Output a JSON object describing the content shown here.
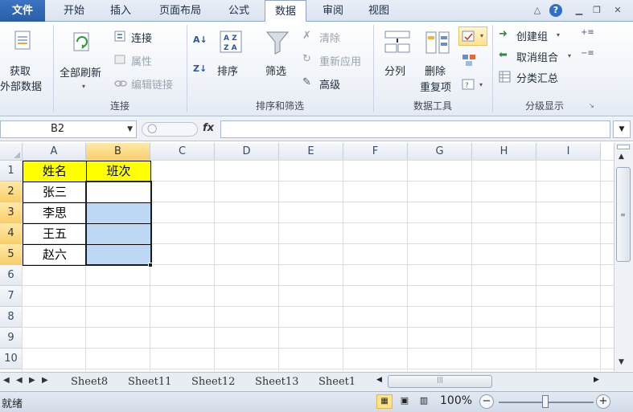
{
  "tabs": {
    "file": "文件",
    "items": [
      "开始",
      "插入",
      "页面布局",
      "公式",
      "数据",
      "审阅",
      "视图"
    ],
    "active": "数据"
  },
  "ribbon": {
    "get_external": {
      "line1": "获取",
      "line2": "外部数据"
    },
    "connections": {
      "refresh_all_line1": "全部刷新",
      "connect": "连接",
      "properties": "属性",
      "edit_links": "编辑链接",
      "title": "连接"
    },
    "sort_filter": {
      "sort": "排序",
      "filter": "筛选",
      "clear": "清除",
      "reapply": "重新应用",
      "advanced": "高级",
      "title": "排序和筛选"
    },
    "data_tools": {
      "text_to_columns": "分列",
      "remove_dup_line1": "删除",
      "remove_dup_line2": "重复项",
      "title": "数据工具"
    },
    "outline": {
      "group": "创建组",
      "ungroup": "取消组合",
      "subtotal": "分类汇总",
      "title": "分级显示"
    }
  },
  "formula_bar": {
    "name_box": "B2",
    "fx": "fx",
    "value": ""
  },
  "grid": {
    "columns": [
      "A",
      "B",
      "C",
      "D",
      "E",
      "F",
      "G",
      "H",
      "I"
    ],
    "rows": [
      "1",
      "2",
      "3",
      "4",
      "5",
      "6",
      "7",
      "8",
      "9",
      "10"
    ],
    "header_row": {
      "A": "姓名",
      "B": "班次"
    },
    "names": [
      "张三",
      "李思",
      "王五",
      "赵六"
    ],
    "selected_range": "B2:B5"
  },
  "sheets": {
    "tabs": [
      "Sheet8",
      "Sheet11",
      "Sheet12",
      "Sheet13",
      "Sheet1"
    ],
    "truncated_last": "Sheet1"
  },
  "status": {
    "ready": "就绪",
    "zoom": "100%"
  },
  "colors": {
    "header_yellow": "#ffff00",
    "selection_blue": "#bcd8f5",
    "file_tab": "#2a5da6"
  }
}
